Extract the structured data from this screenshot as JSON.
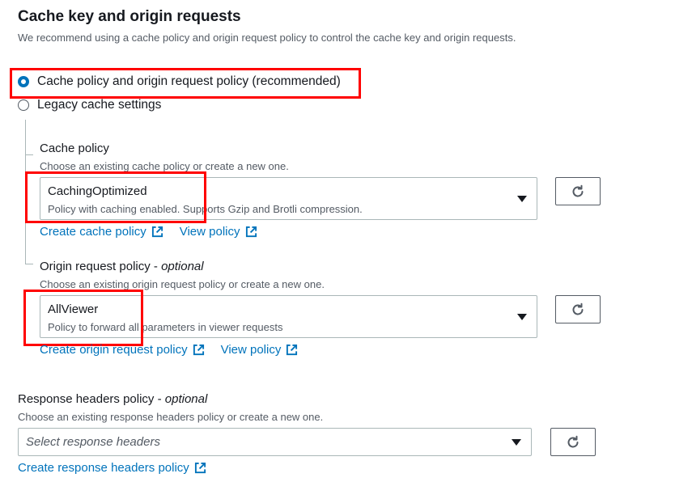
{
  "section": {
    "title": "Cache key and origin requests",
    "description": "We recommend using a cache policy and origin request policy to control the cache key and origin requests."
  },
  "options": {
    "recommended": "Cache policy and origin request policy (recommended)",
    "legacy": "Legacy cache settings",
    "selected": "recommended"
  },
  "cache_policy": {
    "label": "Cache policy",
    "description": "Choose an existing cache policy or create a new one.",
    "selected_name": "CachingOptimized",
    "selected_desc": "Policy with caching enabled. Supports Gzip and Brotli compression.",
    "create_link": "Create cache policy",
    "view_link": "View policy"
  },
  "origin_request_policy": {
    "label": "Origin request policy - ",
    "label_optional": "optional",
    "description": "Choose an existing origin request policy or create a new one.",
    "selected_name": "AllViewer",
    "selected_desc": "Policy to forward all parameters in viewer requests",
    "create_link": "Create origin request policy",
    "view_link": "View policy"
  },
  "response_headers_policy": {
    "label": "Response headers policy - ",
    "label_optional": "optional",
    "description": "Choose an existing response headers policy or create a new one.",
    "placeholder": "Select response headers",
    "create_link": "Create response headers policy"
  },
  "colors": {
    "link": "#0073bb",
    "highlight": "#ff0000",
    "selected_radio": "#0073bb"
  },
  "icons": {
    "refresh": "refresh-icon",
    "external": "external-link-icon",
    "caret": "caret-down-icon"
  }
}
